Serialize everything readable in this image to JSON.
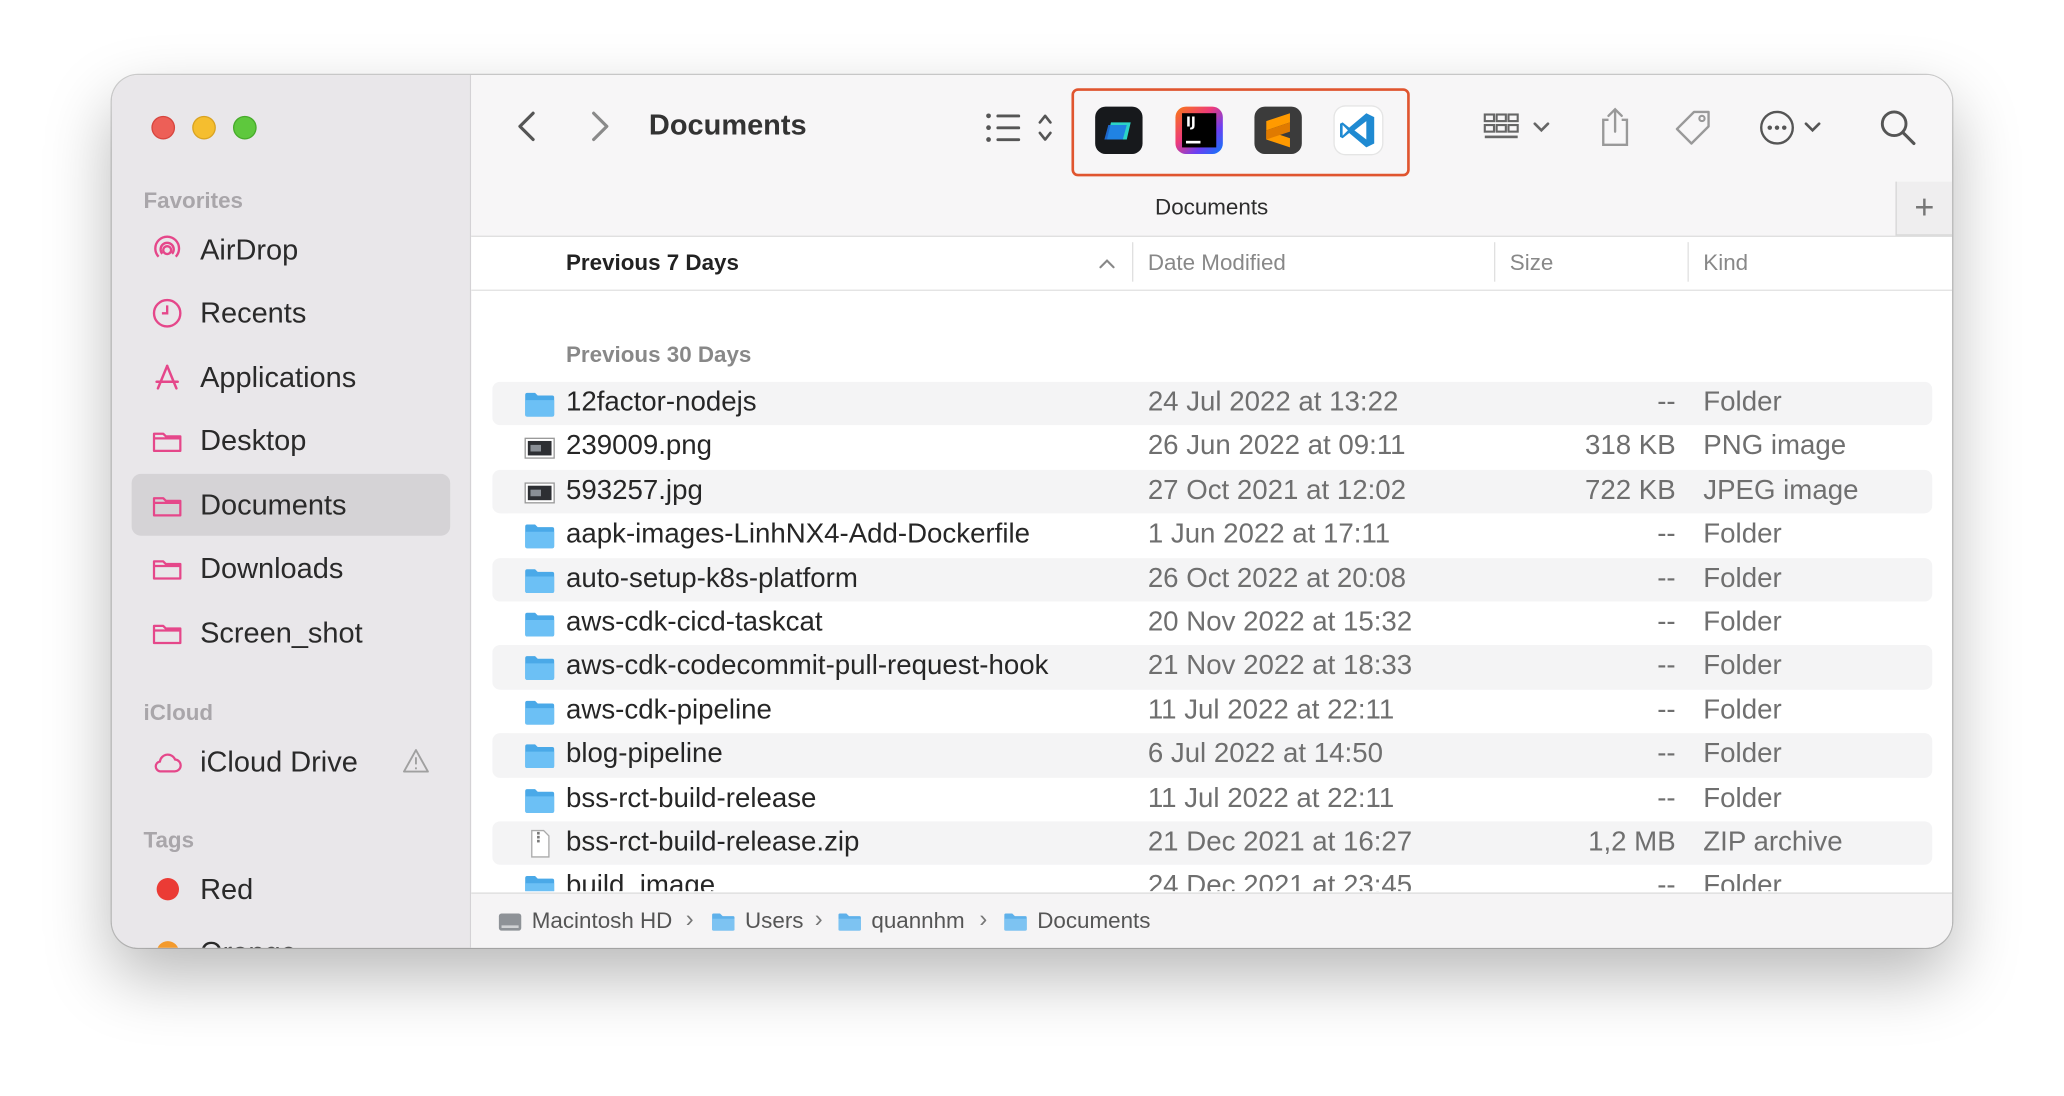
{
  "window": {
    "title": "Documents",
    "path_title": "Documents"
  },
  "sidebar": {
    "sections": {
      "favorites": "Favorites",
      "icloud": "iCloud",
      "tags": "Tags"
    },
    "favorites": [
      {
        "label": "AirDrop",
        "icon": "airdrop-icon"
      },
      {
        "label": "Recents",
        "icon": "clock-icon"
      },
      {
        "label": "Applications",
        "icon": "applications-icon"
      },
      {
        "label": "Desktop",
        "icon": "folder-icon"
      },
      {
        "label": "Documents",
        "icon": "folder-icon",
        "selected": true
      },
      {
        "label": "Downloads",
        "icon": "folder-icon"
      },
      {
        "label": "Screen_shot",
        "icon": "folder-icon"
      }
    ],
    "icloud": [
      {
        "label": "iCloud Drive",
        "icon": "cloud-icon",
        "warning_icon": "warning-icon"
      }
    ],
    "tags": [
      {
        "label": "Red",
        "color": "#eb3b35"
      },
      {
        "label": "Orange",
        "color": "#f39a2d"
      }
    ]
  },
  "toolbar": {
    "view_mode_icon": "list-view-icon",
    "apps": [
      "Warp",
      "IntelliJ IDEA",
      "Sublime Text",
      "Visual Studio Code"
    ],
    "highlight_color": "#e0552f",
    "icons": [
      "grid-view-icon",
      "share-icon",
      "tag-icon",
      "more-icon",
      "search-icon"
    ],
    "plus": "+"
  },
  "columns": {
    "name": "Previous 7 Days",
    "date": "Date Modified",
    "size": "Size",
    "kind": "Kind"
  },
  "group_label": "Previous 30 Days",
  "files": [
    {
      "name": "12factor-nodejs",
      "date": "24 Jul 2022 at 13:22",
      "size": "--",
      "kind": "Folder",
      "type": "folder"
    },
    {
      "name": "239009.png",
      "date": "26 Jun 2022 at 09:11",
      "size": "318 KB",
      "kind": "PNG image",
      "type": "image"
    },
    {
      "name": "593257.jpg",
      "date": "27 Oct 2021 at 12:02",
      "size": "722 KB",
      "kind": "JPEG image",
      "type": "image"
    },
    {
      "name": "aapk-images-LinhNX4-Add-Dockerfile",
      "date": "1 Jun 2022 at 17:11",
      "size": "--",
      "kind": "Folder",
      "type": "folder"
    },
    {
      "name": "auto-setup-k8s-platform",
      "date": "26 Oct 2022 at 20:08",
      "size": "--",
      "kind": "Folder",
      "type": "folder"
    },
    {
      "name": "aws-cdk-cicd-taskcat",
      "date": "20 Nov 2022 at 15:32",
      "size": "--",
      "kind": "Folder",
      "type": "folder"
    },
    {
      "name": "aws-cdk-codecommit-pull-request-hook",
      "date": "21 Nov 2022 at 18:33",
      "size": "--",
      "kind": "Folder",
      "type": "folder"
    },
    {
      "name": "aws-cdk-pipeline",
      "date": "11 Jul 2022 at 22:11",
      "size": "--",
      "kind": "Folder",
      "type": "folder"
    },
    {
      "name": "blog-pipeline",
      "date": "6 Jul 2022 at 14:50",
      "size": "--",
      "kind": "Folder",
      "type": "folder"
    },
    {
      "name": "bss-rct-build-release",
      "date": "11 Jul 2022 at 22:11",
      "size": "--",
      "kind": "Folder",
      "type": "folder"
    },
    {
      "name": "bss-rct-build-release.zip",
      "date": "21 Dec 2021 at 16:27",
      "size": "1,2 MB",
      "kind": "ZIP archive",
      "type": "zip"
    },
    {
      "name": "build_image",
      "date": "24 Dec 2021 at 23:45",
      "size": "--",
      "kind": "Folder",
      "type": "folder"
    }
  ],
  "pathbar": [
    "Macintosh HD",
    "Users",
    "quannhm",
    "Documents"
  ],
  "pathbar_sep": "›"
}
